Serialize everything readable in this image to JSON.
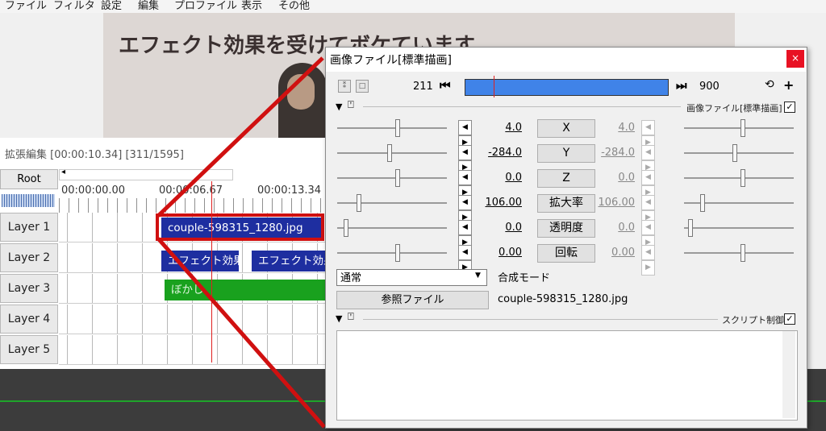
{
  "menubar": {
    "items": [
      "ファイル",
      "フィルタ",
      "設定",
      "編集",
      "プロファイル",
      "表示",
      "その他"
    ]
  },
  "preview": {
    "caption": "エフェクト効果を受けてボケています"
  },
  "timeline": {
    "title": "拡張編集 [00:00:10.34] [311/1595]",
    "root_label": "Root",
    "timecodes": [
      "00:00:00.00",
      "00:00:06.67",
      "00:00:13.34"
    ],
    "layers": [
      "Layer 1",
      "Layer 2",
      "Layer 3",
      "Layer 4",
      "Layer 5"
    ],
    "clips": {
      "layer1": "couple-598315_1280.jpg",
      "layer2a": "エフェクト効果を",
      "layer2b": "エフェクト効果を",
      "layer3": "ぼかし"
    }
  },
  "dialog": {
    "title": "画像ファイル[標準描画]",
    "close_glyph": "×",
    "frame_current": "211",
    "frame_end": "900",
    "section_label": "画像ファイル[標準描画]",
    "params": [
      {
        "name": "X",
        "value": "4.0",
        "end_value": "4.0"
      },
      {
        "name": "Y",
        "value": "-284.0",
        "end_value": "-284.0"
      },
      {
        "name": "Z",
        "value": "0.0",
        "end_value": "0.0"
      },
      {
        "name": "拡大率",
        "value": "106.00",
        "end_value": "106.00"
      },
      {
        "name": "透明度",
        "value": "0.0",
        "end_value": "0.0"
      },
      {
        "name": "回転",
        "value": "0.00",
        "end_value": "0.00"
      }
    ],
    "blend_mode": "通常",
    "blend_label": "合成モード",
    "ref_button": "参照ファイル",
    "file_name": "couple-598315_1280.jpg",
    "script_label": "スクリプト制御"
  },
  "colors": {
    "accent_red": "#d01010",
    "seekbar_blue": "#4083e8",
    "clip_blue": "#1e2ea0",
    "clip_green": "#19a11e"
  }
}
